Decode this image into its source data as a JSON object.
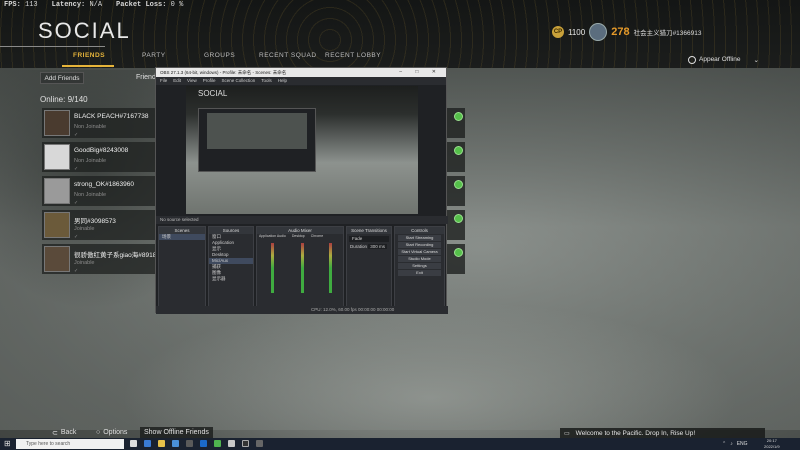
{
  "stats": {
    "fps_label": "FPS:",
    "fps": "113",
    "latency_label": "Latency:",
    "latency": "N/A",
    "packet_label": "Packet Loss:",
    "packet": "0 %"
  },
  "header": {
    "title": "SOCIAL",
    "tabs": [
      "FRIENDS",
      "PARTY",
      "GROUPS",
      "RECENT SQUAD",
      "RECENT LOBBY"
    ],
    "active_tab": "FRIENDS"
  },
  "profile": {
    "cod_points": "1100",
    "level": "278",
    "username": "社会主义猎刀#1366913"
  },
  "presence": {
    "label": "Appear Offline"
  },
  "friends_panel": {
    "add_label": "Add Friends",
    "friends_label": "Friends",
    "online_label": "Online: 9/140"
  },
  "friends": [
    {
      "name": "BLACK PEACH#7167738",
      "status": "Non Joinable"
    },
    {
      "name": "GoodBig#8243008",
      "status": "Non Joinable"
    },
    {
      "name": "strong_OK#1863960",
      "status": "Non Joinable"
    },
    {
      "name": "男同#3098573",
      "status": "Joinable"
    },
    {
      "name": "很骄傲红黄子系giao海#8918",
      "status": "Joinable"
    }
  ],
  "obs": {
    "title": "OBS 27.1.3 (64-bit, windows) - Profile: 未命名 - Scenes: 未命名",
    "menu": [
      "File",
      "Edit",
      "View",
      "Profile",
      "Scene Collection",
      "Tools",
      "Help"
    ],
    "status": "No source selected",
    "docks": {
      "scenes": "Scenes",
      "sources": "Sources",
      "mixer": "Audio Mixer",
      "transitions": "Scene Transitions",
      "controls": "Controls"
    },
    "scene_items": [
      "场景"
    ],
    "source_items": [
      "窗口",
      "Application",
      "显示",
      "Desktop",
      "Mic/Aux",
      "捕获",
      "图像",
      "显示器"
    ],
    "mixer_channels": [
      "Application Audio",
      "Desktop",
      "Chrome"
    ],
    "transition": {
      "type": "Fade",
      "duration_label": "Duration",
      "duration": "300 ms"
    },
    "controls": [
      "Start Streaming",
      "Start Recording",
      "Start Virtual Camera",
      "Studio Mode",
      "Settings",
      "Exit"
    ],
    "footer": "CPU: 12.0%, 60.00 fps   00:00:00   00:00:00"
  },
  "bottom": {
    "back": "Back",
    "options": "Options",
    "offline": "Show Offline Friends",
    "notification": "Welcome to the Pacific. Drop In, Rise Up!"
  },
  "taskbar": {
    "search_placeholder": "Type here to search",
    "tray": "ENG",
    "time": "20:17",
    "date": "2022/1/9"
  },
  "colors": {
    "accent": "#e6b43a",
    "level": "#e69a2a",
    "online": "#55c04a"
  }
}
